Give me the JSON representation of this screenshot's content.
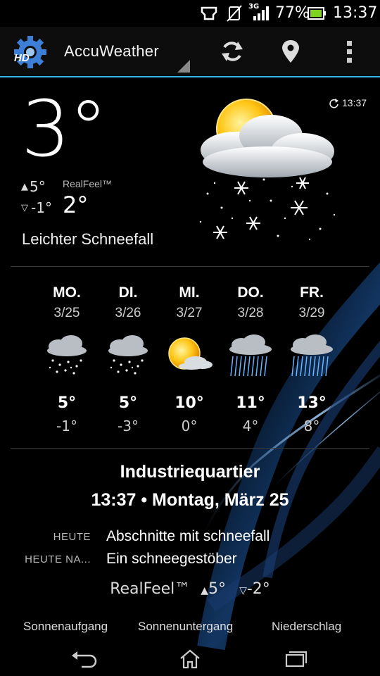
{
  "status_bar": {
    "battery": "77%",
    "time": "13:37",
    "network": "3G"
  },
  "app": {
    "title": "AccuWeather",
    "logo_badge": "HD"
  },
  "current": {
    "temperature": "3°",
    "high": "5°",
    "low": "-1°",
    "realfeel_label": "RealFeel™",
    "realfeel_value": "2°",
    "condition": "Leichter Schneefall",
    "updated_time": "13:37"
  },
  "forecast": [
    {
      "day": "MO.",
      "date": "3/25",
      "high": "5°",
      "low": "-1°",
      "icon": "snow-icon"
    },
    {
      "day": "DI.",
      "date": "3/26",
      "high": "5°",
      "low": "-3°",
      "icon": "snow-icon"
    },
    {
      "day": "MI.",
      "date": "3/27",
      "high": "10°",
      "low": "0°",
      "icon": "sun-cloud-icon"
    },
    {
      "day": "DO.",
      "date": "3/28",
      "high": "11°",
      "low": "4°",
      "icon": "rain-icon"
    },
    {
      "day": "FR.",
      "date": "3/29",
      "high": "13°",
      "low": "8°",
      "icon": "rain-icon"
    }
  ],
  "location": {
    "name": "Industriequartier",
    "datetime": "13:37  •  Montag, März 25"
  },
  "summary": {
    "today_label": "HEUTE",
    "today_text": "Abschnitte mit schneefall",
    "tonight_label": "HEUTE NA...",
    "tonight_text": "Ein schneegestöber"
  },
  "realfeel_row": {
    "label": "RealFeel™",
    "high": "5°",
    "low": "-2°"
  },
  "bottom_tabs": [
    "Sonnenaufgang",
    "Sonnenuntergang",
    "Niederschlag"
  ],
  "colors": {
    "accent": "#33b5e5",
    "background": "#000000"
  }
}
